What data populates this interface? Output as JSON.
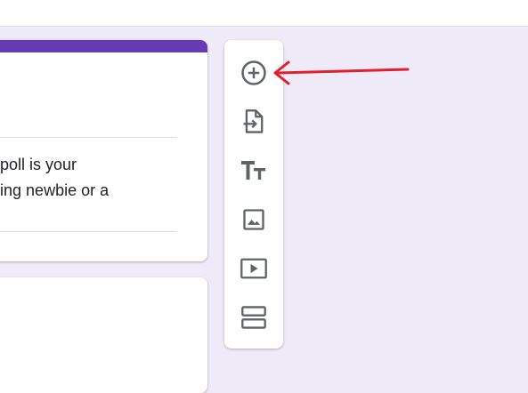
{
  "form": {
    "description_lines": [
      "ef poll is your",
      "oding newbie or a"
    ]
  },
  "toolbar": {
    "tools": [
      {
        "icon": "add-circle-icon",
        "label": "Add question"
      },
      {
        "icon": "import-icon",
        "label": "Import questions"
      },
      {
        "icon": "title-text-icon",
        "label": "Add title and description"
      },
      {
        "icon": "image-icon",
        "label": "Add image"
      },
      {
        "icon": "video-icon",
        "label": "Add video"
      },
      {
        "icon": "section-icon",
        "label": "Add section"
      }
    ]
  },
  "colors": {
    "accent": "#673ab7",
    "background": "#efeaf8",
    "icon": "#5f6368",
    "annotation_arrow": "#e0202e"
  }
}
